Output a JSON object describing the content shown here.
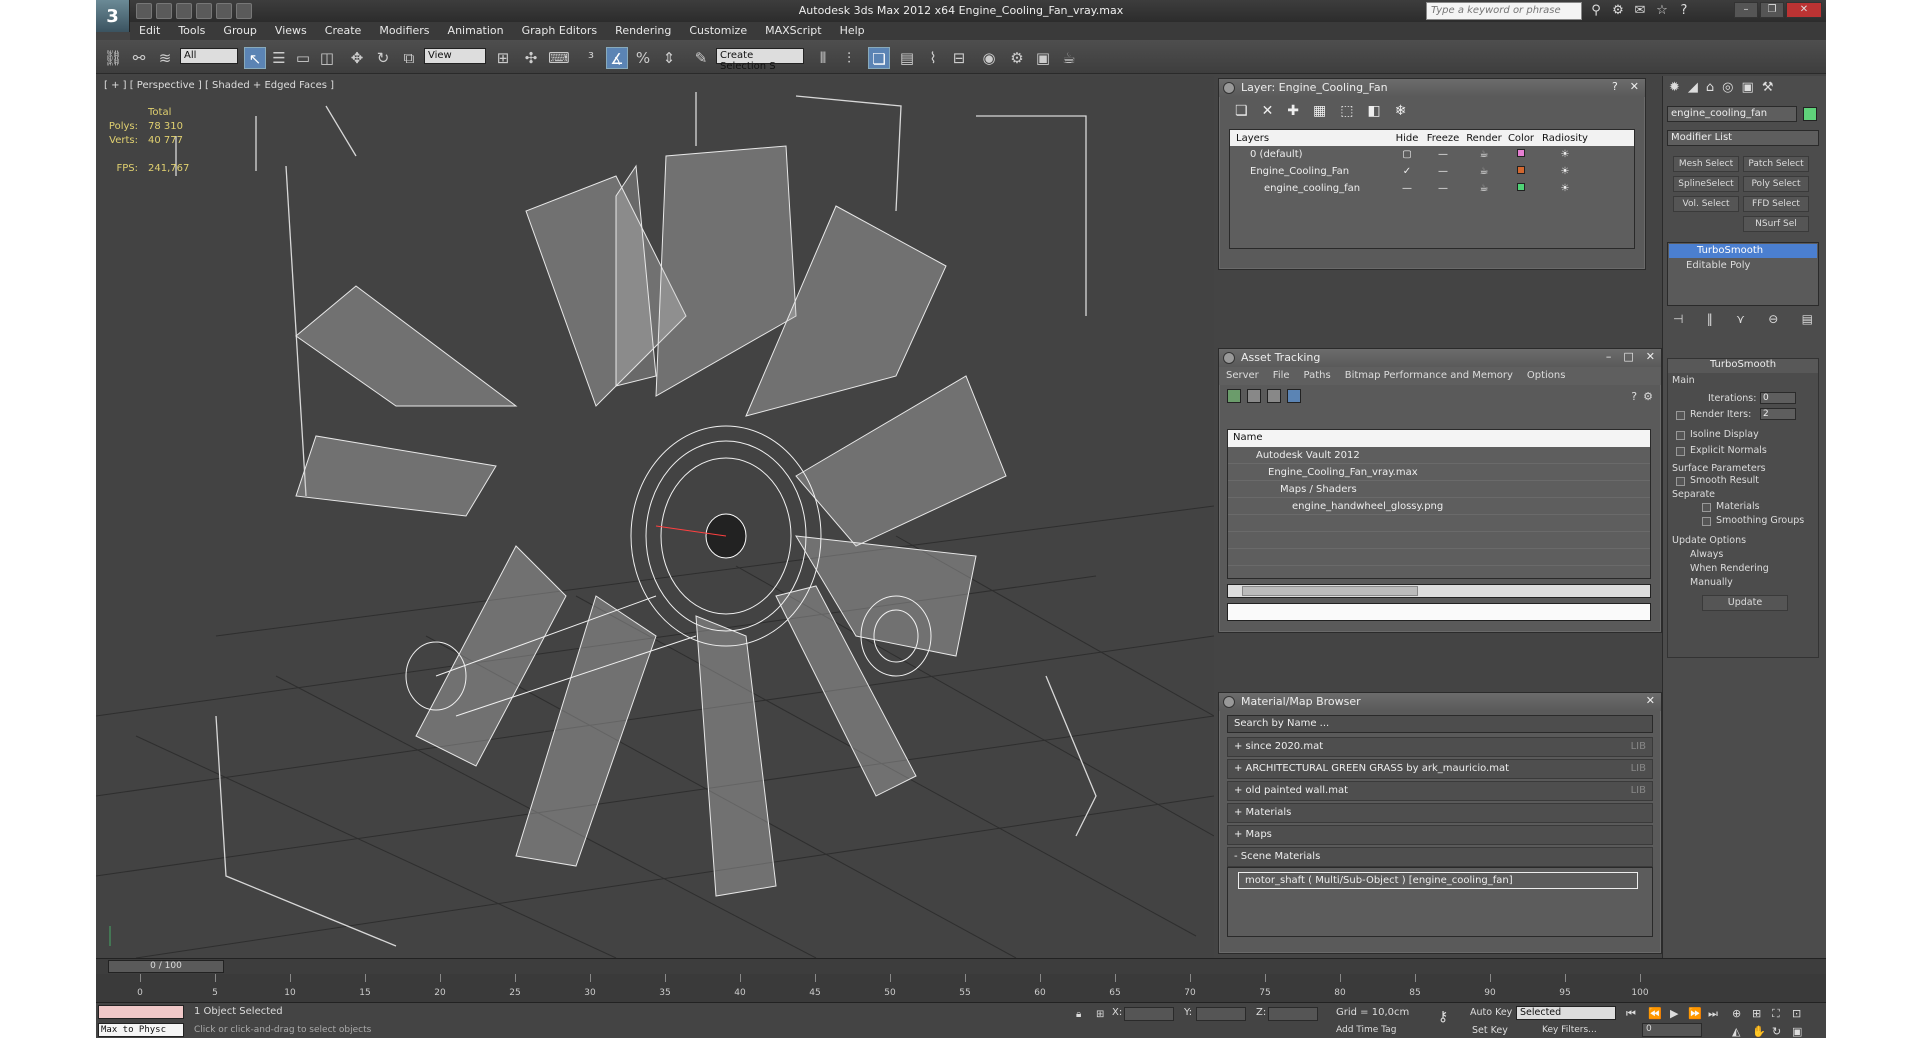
{
  "window": {
    "title": "Autodesk 3ds Max 2012 x64      Engine_Cooling_Fan_vray.max",
    "search_placeholder": "Type a keyword or phrase",
    "logo": "3"
  },
  "menu": [
    "Edit",
    "Tools",
    "Group",
    "Views",
    "Create",
    "Modifiers",
    "Animation",
    "Graph Editors",
    "Rendering",
    "Customize",
    "MAXScript",
    "Help"
  ],
  "toolbar": {
    "filter": "All",
    "ref_coord": "View",
    "selection_set": "Create Selection S"
  },
  "viewport": {
    "label": "[ + ] [ Perspective ] [ Shaded + Edged Faces ]",
    "stats": {
      "header": "Total",
      "polys_label": "Polys:",
      "polys": "78 310",
      "verts_label": "Verts:",
      "verts": "40 777",
      "fps_label": "FPS:",
      "fps": "241,767"
    }
  },
  "layer_panel": {
    "title": "Layer: Engine_Cooling_Fan",
    "columns": [
      "Layers",
      "Hide",
      "Freeze",
      "Render",
      "Color",
      "Radiosity"
    ],
    "rows": [
      {
        "name": "0 (default)",
        "color": "#e67fd2"
      },
      {
        "name": "Engine_Cooling_Fan",
        "color": "#d2672f"
      },
      {
        "name": "engine_cooling_fan",
        "color": "#4fd276"
      }
    ]
  },
  "asset_panel": {
    "title": "Asset Tracking",
    "menu": [
      "Server",
      "File",
      "Paths",
      "Bitmap Performance and Memory",
      "Options"
    ],
    "column": "Name",
    "rows": [
      "Autodesk Vault 2012",
      "Engine_Cooling_Fan_vray.max",
      "Maps / Shaders",
      "engine_handwheel_glossy.png"
    ]
  },
  "material_panel": {
    "title": "Material/Map Browser",
    "search": "Search by Name ...",
    "lib_tag": "LIB",
    "groups": [
      {
        "label": "+ since 2020.mat",
        "lib": true
      },
      {
        "label": "+ ARCHITECTURAL GREEN GRASS by ark_mauricio.mat",
        "lib": true
      },
      {
        "label": "+ old painted wall.mat",
        "lib": true
      },
      {
        "label": "+ Materials",
        "lib": false
      },
      {
        "label": "+ Maps",
        "lib": false
      },
      {
        "label": "- Scene Materials",
        "lib": false
      }
    ],
    "scene_item": "motor_shaft  ( Multi/Sub-Object )  [engine_cooling_fan]"
  },
  "command_panel": {
    "object_name": "engine_cooling_fan",
    "modifier_list": "Modifier List",
    "buttons": [
      "Mesh Select",
      "Patch Select",
      "SplineSelect",
      "Poly Select",
      "Vol. Select",
      "FFD Select",
      "NSurf Sel"
    ],
    "stack": [
      "TurboSmooth",
      "Editable Poly"
    ],
    "turbosmooth": {
      "title": "TurboSmooth",
      "main": "Main",
      "iterations_label": "Iterations:",
      "iterations": "0",
      "render_iters_label": "Render Iters:",
      "render_iters": "2",
      "isoline": "Isoline Display",
      "explicit": "Explicit Normals",
      "surface": "Surface Parameters",
      "smooth_result": "Smooth Result",
      "separate": "Separate",
      "materials": "Materials",
      "smoothing_groups": "Smoothing Groups",
      "update_options": "Update Options",
      "always": "Always",
      "when_rendering": "When Rendering",
      "manually": "Manually",
      "update": "Update"
    }
  },
  "timeline": {
    "position": "0 / 100",
    "ticks": [
      "0",
      "5",
      "10",
      "15",
      "20",
      "25",
      "30",
      "35",
      "40",
      "45",
      "50",
      "55",
      "60",
      "65",
      "70",
      "75",
      "80",
      "85",
      "90",
      "95",
      "100"
    ]
  },
  "status": {
    "maxscript": "Max to Physc",
    "selected": "1 Object Selected",
    "prompt": "Click or click-and-drag to select objects",
    "x_label": "X:",
    "y_label": "Y:",
    "z_label": "Z:",
    "grid": "Grid = 10,0cm",
    "add_time_tag": "Add Time Tag",
    "auto_key": "Auto Key",
    "set_key": "Set Key",
    "selected_drop": "Selected",
    "key_filters": "Key Filters...",
    "frame": "0"
  }
}
